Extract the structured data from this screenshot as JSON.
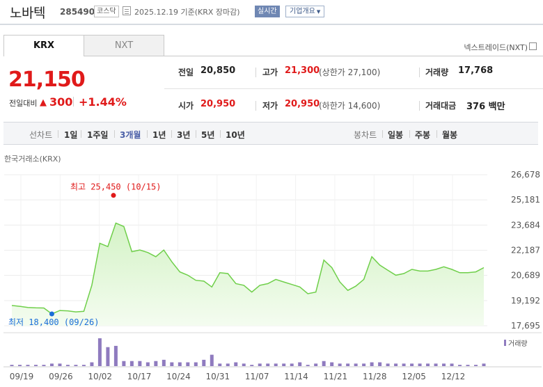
{
  "header": {
    "name": "노바텍",
    "code": "285490",
    "market": "코스닥",
    "date": "2025.12.19",
    "basis": "기준(KRX 장마감)",
    "realtime": "실시간",
    "company_btn": "기업개요"
  },
  "tabs": [
    {
      "label": "KRX",
      "active": true
    },
    {
      "label": "NXT",
      "active": false
    }
  ],
  "nxt_toggle": "넥스트레이드(NXT)",
  "quote": {
    "price": "21,150",
    "diff_label": "전일대비",
    "diff_arrow": "▲",
    "diff": "300",
    "pct": "+1.44%"
  },
  "stats": {
    "prev_label": "전일",
    "prev": "20,850",
    "high_label": "고가",
    "high": "21,300",
    "upper": "(상한가 27,100)",
    "volume_label": "거래량",
    "volume": "17,768",
    "open_label": "시가",
    "open": "20,950",
    "low_label": "저가",
    "low": "20,950",
    "lower": "(하한가 14,600)",
    "amount_label": "거래대금",
    "amount": "376 백만"
  },
  "periods": {
    "line_label": "선차트",
    "line": [
      "1일",
      "1주일",
      "3개월",
      "1년",
      "3년",
      "5년",
      "10년"
    ],
    "active": "3개월",
    "candle_label": "봉차트",
    "candle": [
      "일봉",
      "주봉",
      "월봉"
    ]
  },
  "exchange_label": "한국거래소(KRX)",
  "colors": {
    "up": "#e01a1a",
    "down": "#1a6ed8",
    "line": "#6fcf4a",
    "area_top": "#d4f3c6",
    "area_bottom": "#f4fcf0",
    "volume": "#8f7bbf",
    "active_period": "#4a5fa7"
  },
  "chart_data": {
    "type": "area",
    "series_price": [
      18900,
      18850,
      18780,
      18760,
      18750,
      18400,
      18600,
      18580,
      18520,
      18550,
      20100,
      22600,
      22400,
      23800,
      23600,
      22100,
      22200,
      22050,
      21800,
      22200,
      21500,
      20900,
      20700,
      20400,
      20350,
      20000,
      20850,
      20800,
      20200,
      20100,
      19700,
      20100,
      20200,
      20450,
      20300,
      20150,
      20000,
      19600,
      19700,
      21600,
      21150,
      20300,
      19800,
      20050,
      20450,
      21800,
      21300,
      21000,
      20700,
      20800,
      21050,
      20950,
      20950,
      21050,
      21200,
      21050,
      20850,
      20850,
      20900,
      21150
    ],
    "series_volume": [
      1,
      1,
      1,
      1,
      1,
      2,
      2,
      1,
      1,
      1,
      3,
      22,
      15,
      16,
      4,
      4,
      4,
      3,
      4,
      5,
      3,
      3,
      3,
      3,
      5,
      9,
      2,
      2,
      3,
      2,
      1,
      2,
      2,
      2,
      2,
      2,
      3,
      1,
      2,
      4,
      3,
      2,
      2,
      2,
      2,
      3,
      3,
      2,
      2,
      2,
      2,
      2,
      2,
      2,
      2,
      2,
      1,
      1,
      1,
      2
    ],
    "y_ticks": [
      "26,678",
      "25,181",
      "23,684",
      "22,187",
      "20,689",
      "19,192",
      "17,695"
    ],
    "ylim": [
      17695,
      26678
    ],
    "x_labels": [
      "09/19",
      "09/26",
      "10/02",
      "10/17",
      "10/24",
      "10/31",
      "11/07",
      "11/14",
      "11/21",
      "11/28",
      "12/05",
      "12/12"
    ],
    "high_annotation": "최고 25,450 (10/15)",
    "low_annotation": "최저 18,400 (09/26)",
    "high_value": 25450,
    "low_value": 18400,
    "volume_legend": "거래량"
  }
}
